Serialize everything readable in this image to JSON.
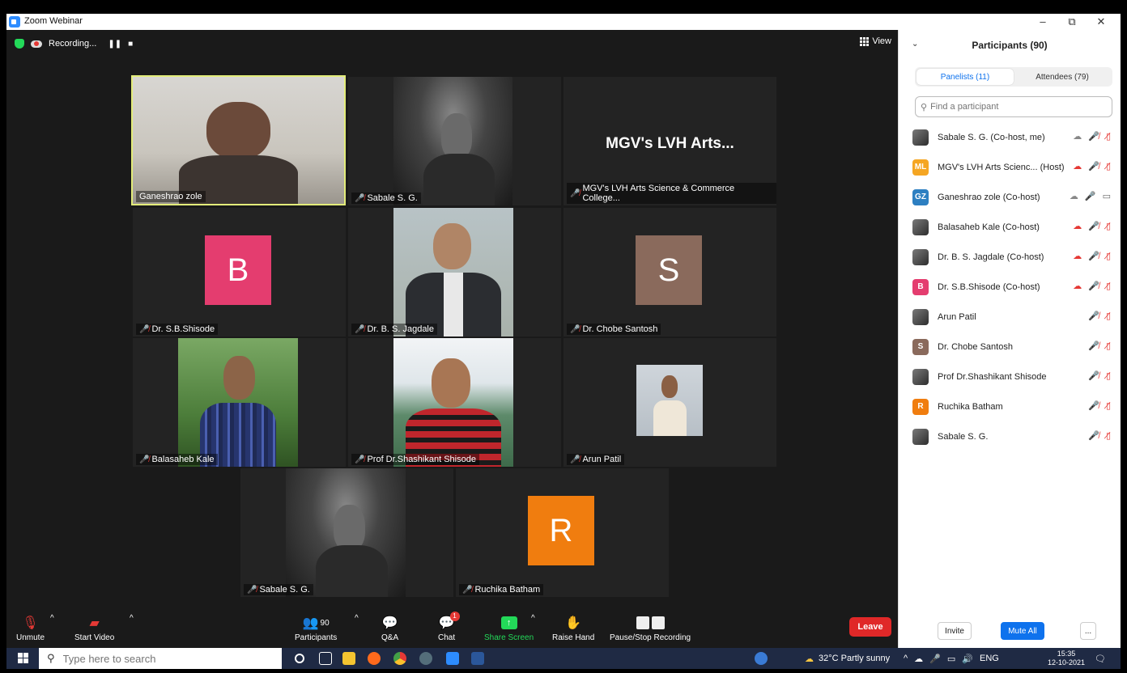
{
  "window": {
    "title": "Zoom Webinar",
    "minimize": "–",
    "restore": "⧉",
    "close": "✕"
  },
  "recording": {
    "label": "Recording...",
    "pause": "❚❚",
    "stop": "■"
  },
  "view_label": "View",
  "tiles": [
    {
      "name": "Ganeshrao zole",
      "muted": false
    },
    {
      "name": "Sabale S. G.",
      "muted": true
    },
    {
      "name": "MGV's LVH Arts Science & Commerce College...",
      "muted": true,
      "center_text": "MGV's LVH Arts..."
    },
    {
      "name": "Dr. S.B.Shisode",
      "muted": true,
      "avatar_letter": "B",
      "avatar_color": "#e43d6f"
    },
    {
      "name": "Dr. B. S. Jagdale",
      "muted": true
    },
    {
      "name": "Dr. Chobe Santosh",
      "muted": true,
      "avatar_letter": "S",
      "avatar_color": "#8a6a5c"
    },
    {
      "name": "Balasaheb Kale",
      "muted": true
    },
    {
      "name": "Prof Dr.Shashikant Shisode",
      "muted": true
    },
    {
      "name": "Arun Patil",
      "muted": true
    },
    {
      "name": "Sabale S. G.",
      "muted": true
    },
    {
      "name": "Ruchika Batham",
      "muted": true,
      "avatar_letter": "R",
      "avatar_color": "#f07d0f"
    }
  ],
  "toolbar": {
    "unmute": "Unmute",
    "start_video": "Start Video",
    "participants": "Participants",
    "participants_count": "90",
    "qa": "Q&A",
    "chat": "Chat",
    "chat_badge": "1",
    "share_screen": "Share Screen",
    "raise_hand": "Raise Hand",
    "pause_stop_recording": "Pause/Stop Recording",
    "leave": "Leave"
  },
  "sidebar": {
    "title": "Participants (90)",
    "tabs": [
      {
        "label": "Panelists (11)",
        "active": true
      },
      {
        "label": "Attendees (79)",
        "active": false
      }
    ],
    "search_placeholder": "Find a participant",
    "participants": [
      {
        "name": "Sabale S. G. (Co-host, me)",
        "avatar": "photo",
        "rec": true,
        "mic": "muted",
        "video": "off"
      },
      {
        "name": "MGV's LVH Arts Scienc... (Host)",
        "avatar": "ML",
        "avatar_color": "#f5a623",
        "rec": true,
        "mic": "muted",
        "video": "off"
      },
      {
        "name": "Ganeshrao zole (Co-host)",
        "avatar": "GZ",
        "avatar_color": "#2d7fc1",
        "rec": true,
        "mic": "on",
        "video": "on"
      },
      {
        "name": "Balasaheb Kale (Co-host)",
        "avatar": "photo",
        "rec": true,
        "mic": "muted",
        "video": "off"
      },
      {
        "name": "Dr. B. S. Jagdale (Co-host)",
        "avatar": "photo",
        "rec": true,
        "mic": "muted",
        "video": "off"
      },
      {
        "name": "Dr. S.B.Shisode (Co-host)",
        "avatar": "B",
        "avatar_color": "#e43d6f",
        "rec": true,
        "mic": "muted",
        "video": "off"
      },
      {
        "name": "Arun Patil",
        "avatar": "photo",
        "rec": false,
        "mic": "muted",
        "video": "off"
      },
      {
        "name": "Dr. Chobe Santosh",
        "avatar": "S",
        "avatar_color": "#8a6a5c",
        "rec": false,
        "mic": "muted",
        "video": "off"
      },
      {
        "name": "Prof Dr.Shashikant Shisode",
        "avatar": "photo",
        "rec": false,
        "mic": "muted",
        "video": "off"
      },
      {
        "name": "Ruchika Batham",
        "avatar": "R",
        "avatar_color": "#f07d0f",
        "rec": false,
        "mic": "muted",
        "video": "off"
      },
      {
        "name": "Sabale S. G.",
        "avatar": "photo",
        "rec": false,
        "mic": "muted",
        "video": "off"
      }
    ],
    "invite": "Invite",
    "mute_all": "Mute All",
    "more": "..."
  },
  "taskbar": {
    "search_placeholder": "Type here to search",
    "weather": "32°C  Partly sunny",
    "lang": "ENG",
    "time": "15:35",
    "date": "12-10-2021"
  }
}
